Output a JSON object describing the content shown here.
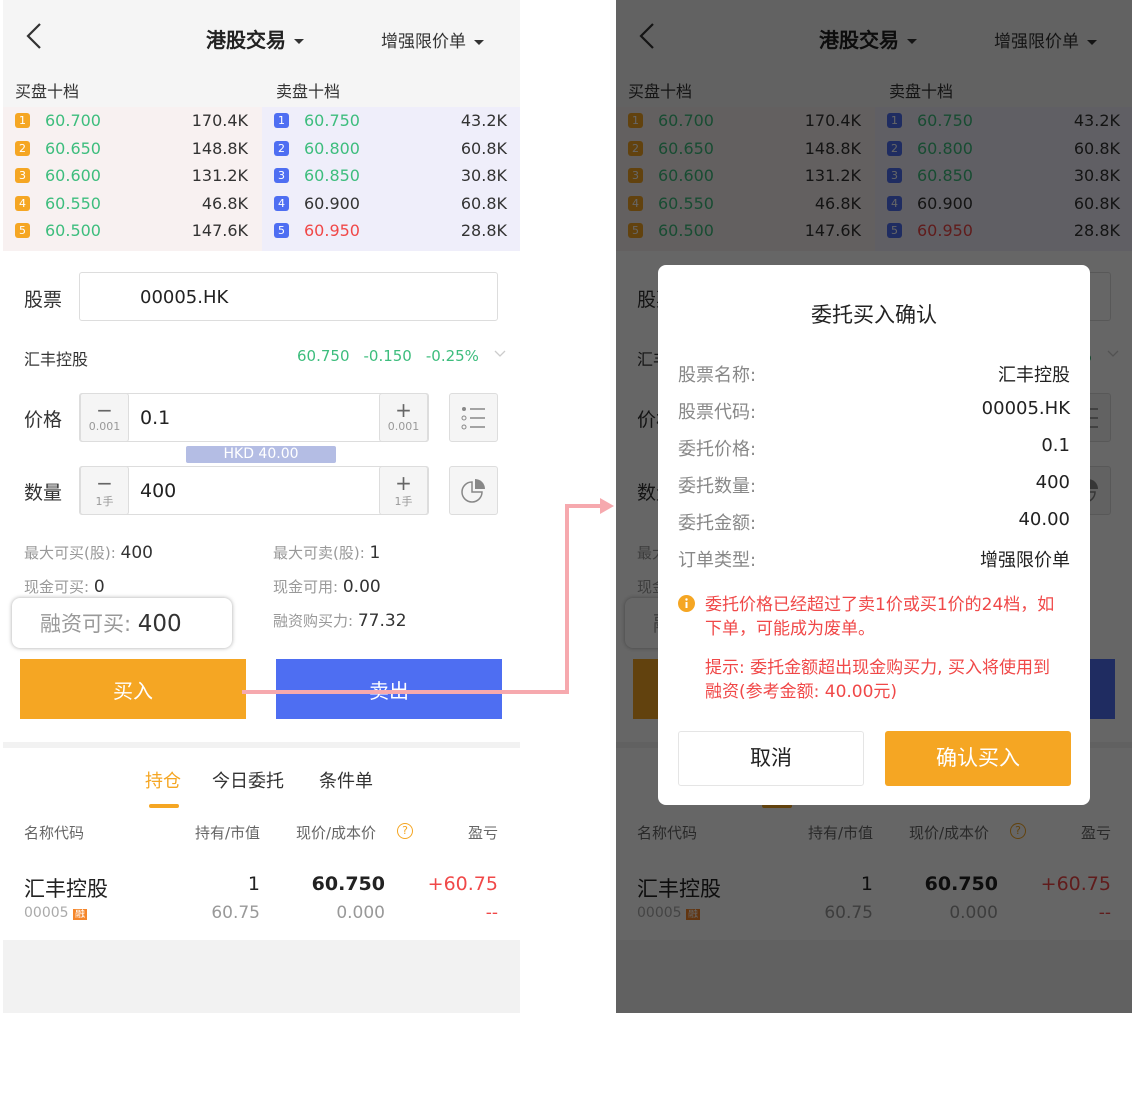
{
  "header": {
    "title": "港股交易",
    "order_type": "增强限价单"
  },
  "order_book": {
    "buy_label": "买盘十档",
    "sell_label": "卖盘十档",
    "buy": [
      {
        "n": "1",
        "price": "60.700",
        "vol": "170.4K"
      },
      {
        "n": "2",
        "price": "60.650",
        "vol": "148.8K"
      },
      {
        "n": "3",
        "price": "60.600",
        "vol": "131.2K"
      },
      {
        "n": "4",
        "price": "60.550",
        "vol": "46.8K"
      },
      {
        "n": "5",
        "price": "60.500",
        "vol": "147.6K"
      }
    ],
    "sell": [
      {
        "n": "1",
        "price": "60.750",
        "vol": "43.2K",
        "color": "g"
      },
      {
        "n": "2",
        "price": "60.800",
        "vol": "60.8K",
        "color": "g"
      },
      {
        "n": "3",
        "price": "60.850",
        "vol": "30.8K",
        "color": "g"
      },
      {
        "n": "4",
        "price": "60.900",
        "vol": "60.8K",
        "color": "k"
      },
      {
        "n": "5",
        "price": "60.950",
        "vol": "28.8K",
        "color": "r"
      }
    ]
  },
  "form": {
    "stock_label": "股票",
    "stock_value": "00005.HK",
    "stock_name": "汇丰控股",
    "quote_price": "60.750",
    "quote_change": "-0.150",
    "quote_pct": "-0.25%",
    "price_label": "价格",
    "price_value": "0.1",
    "price_step": "0.001",
    "amount_tag": "HKD 40.00",
    "qty_label": "数量",
    "qty_value": "400",
    "qty_step": "1手",
    "max_buy_label": "最大可买(股):",
    "max_buy": "400",
    "max_sell_label": "最大可卖(股):",
    "max_sell": "1",
    "cash_buy_label": "现金可买:",
    "cash_buy": "0",
    "cash_avail_label": "现金可用:",
    "cash_avail": "0.00",
    "margin_buy_label": "融资可买:",
    "margin_buy": "400",
    "margin_power_label": "融资购买力:",
    "margin_power": "77.32",
    "buy_button": "买入",
    "sell_button": "卖出"
  },
  "tabs": [
    "持仓",
    "今日委托",
    "条件单"
  ],
  "positions": {
    "headers": [
      "名称代码",
      "持有/市值",
      "现价/成本价",
      "盈亏"
    ],
    "rows": [
      {
        "name": "汇丰控股",
        "code": "00005",
        "tag": "融",
        "qty": "1",
        "value": "60.75",
        "price": "60.750",
        "cost": "0.000",
        "pl": "+60.75",
        "pl2": "--"
      }
    ]
  },
  "dialog": {
    "title": "委托买入确认",
    "rows": [
      {
        "label": "股票名称:",
        "value": "汇丰控股"
      },
      {
        "label": "股票代码:",
        "value": "00005.HK"
      },
      {
        "label": "委托价格:",
        "value": "0.1"
      },
      {
        "label": "委托数量:",
        "value": "400"
      },
      {
        "label": "委托金额:",
        "value": "40.00"
      },
      {
        "label": "订单类型:",
        "value": "增强限价单"
      }
    ],
    "warning": "委托价格已经超过了卖1价或买1价的24档，如下单，可能成为废单。",
    "hint": "提示: 委托金额超出现金购买力, 买入将使用到融资(参考金额: 40.00元)",
    "cancel": "取消",
    "confirm": "确认买入"
  },
  "colors": {
    "orange": "#f5a623",
    "blue": "#4e6ef2",
    "green": "#3dbd7d",
    "red": "#f04848"
  }
}
